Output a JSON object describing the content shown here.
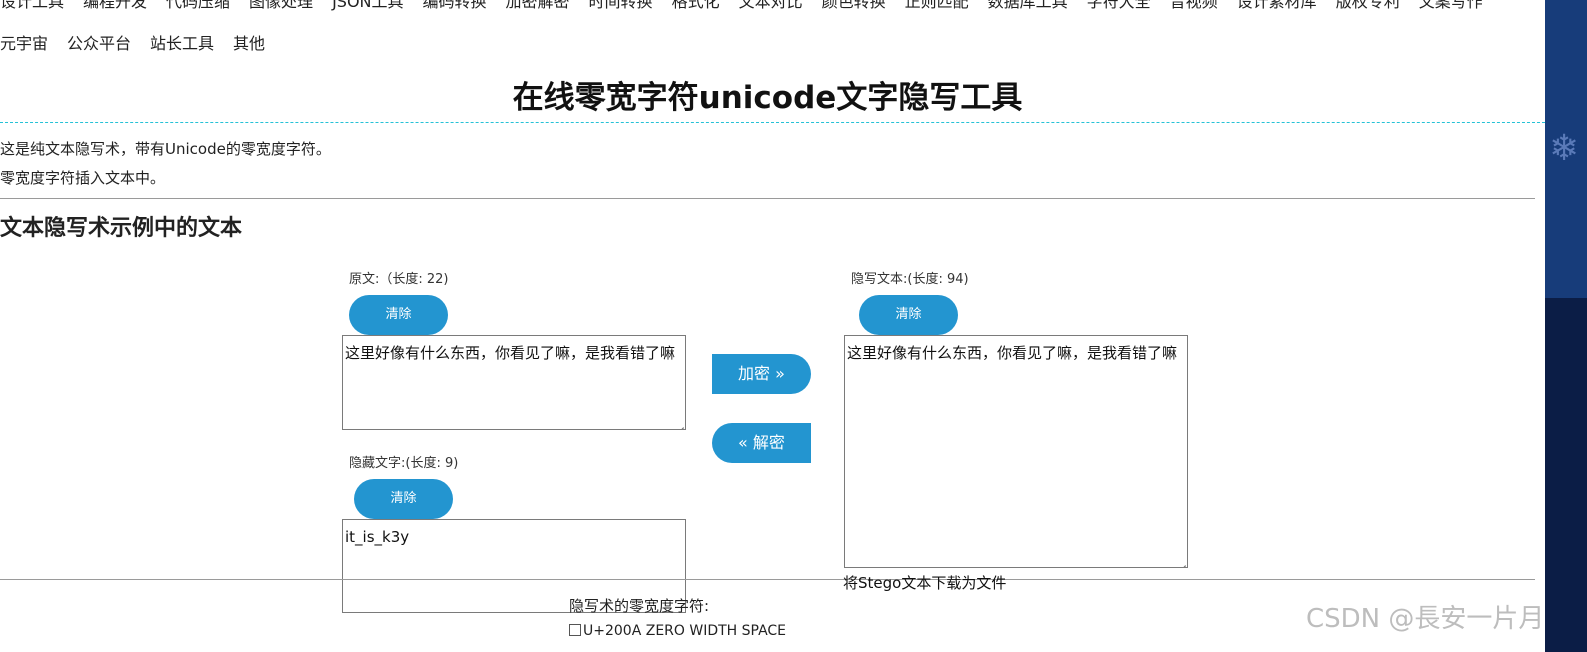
{
  "nav": {
    "row1": [
      "设计工具",
      "编程开发",
      "代码压缩",
      "图像处理",
      "JSON工具",
      "编码转换",
      "加密解密",
      "时间转换",
      "格式化",
      "文本对比",
      "颜色转换",
      "正则匹配",
      "数据库工具",
      "字符大全",
      "音视频",
      "设计素材库",
      "版权专利",
      "文案写作"
    ],
    "row2": [
      "元宇宙",
      "公众平台",
      "站长工具",
      "其他"
    ]
  },
  "page": {
    "title": "在线零宽字符unicode文字隐写工具",
    "desc1": "这是纯文本隐写术，带有Unicode的零宽度字符。",
    "desc2": "零宽度字符插入文本中。",
    "section_title": "文本隐写术示例中的文本"
  },
  "original": {
    "label": "原文:（长度: 22)",
    "clear": "清除",
    "text": "这里好像有什么东西，你看见了嘛，是我看错了嘛"
  },
  "hidden": {
    "label": "隐藏文字:(长度: 9)",
    "clear": "清除",
    "text": "it_is_k3y"
  },
  "stego": {
    "label": "隐写文本:(长度: 94)",
    "clear": "清除",
    "text": "这里好像有什么东西，你看见了嘛，是我看错了嘛",
    "download": "将Stego文本下载为文件"
  },
  "actions": {
    "encrypt": "加密 »",
    "decrypt": "« 解密"
  },
  "zero_width": {
    "label": "隐写术的零宽度字符:",
    "option1": "U+200A ZERO WIDTH SPACE"
  },
  "watermark": "CSDN @長安一片月",
  "colors": {
    "accent": "#2395d0",
    "divider_dashed": "#26c2d6"
  }
}
